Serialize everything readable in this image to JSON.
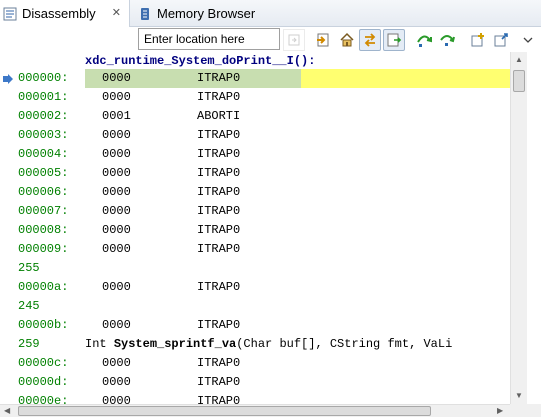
{
  "tabs": [
    {
      "label": "Disassembly",
      "active": true,
      "close": "✕"
    },
    {
      "label": "Memory Browser",
      "active": false
    }
  ],
  "toolbar": {
    "location_value": "Enter location here",
    "buttons": [
      "go-to-location-icon",
      "show-program-counter-icon",
      "home-icon",
      "link-with-debug-context-icon",
      "refresh-icon",
      "step-over-icon",
      "step-into-icon",
      "new-view-icon",
      "pin-icon",
      "view-menu-icon"
    ]
  },
  "colors": {
    "address": "#008000",
    "label": "#00007f",
    "pc_highlight": "#c8deb0",
    "line_highlight": "#ffff70"
  },
  "disassembly": {
    "function_label": "xdc_runtime_System_doPrint__I():",
    "rows": [
      {
        "addr": "000000:",
        "op": "0000",
        "mn": "ITRAP0"
      },
      {
        "addr": "000001:",
        "op": "0000",
        "mn": "ITRAP0"
      },
      {
        "addr": "000002:",
        "op": "0001",
        "mn": "ABORTI"
      },
      {
        "addr": "000003:",
        "op": "0000",
        "mn": "ITRAP0"
      },
      {
        "addr": "000004:",
        "op": "0000",
        "mn": "ITRAP0"
      },
      {
        "addr": "000005:",
        "op": "0000",
        "mn": "ITRAP0"
      },
      {
        "addr": "000006:",
        "op": "0000",
        "mn": "ITRAP0"
      },
      {
        "addr": "000007:",
        "op": "0000",
        "mn": "ITRAP0"
      },
      {
        "addr": "000008:",
        "op": "0000",
        "mn": "ITRAP0"
      },
      {
        "addr": "000009:",
        "op": "0000",
        "mn": "ITRAP0"
      }
    ],
    "src1_line": "255",
    "row_a": {
      "addr": "00000a:",
      "op": "0000",
      "mn": "ITRAP0"
    },
    "src2_line": "245",
    "row_b": {
      "addr": "00000b:",
      "op": "0000",
      "mn": "ITRAP0"
    },
    "src3_line": "259",
    "src3_prefix": "Int ",
    "src3_func": "System_sprintf_va",
    "src3_args": "(Char buf[], CString fmt, VaLi",
    "rows_tail": [
      {
        "addr": "00000c:",
        "op": "0000",
        "mn": "ITRAP0"
      },
      {
        "addr": "00000d:",
        "op": "0000",
        "mn": "ITRAP0"
      },
      {
        "addr": "00000e:",
        "op": "0000",
        "mn": "ITRAP0"
      }
    ]
  }
}
